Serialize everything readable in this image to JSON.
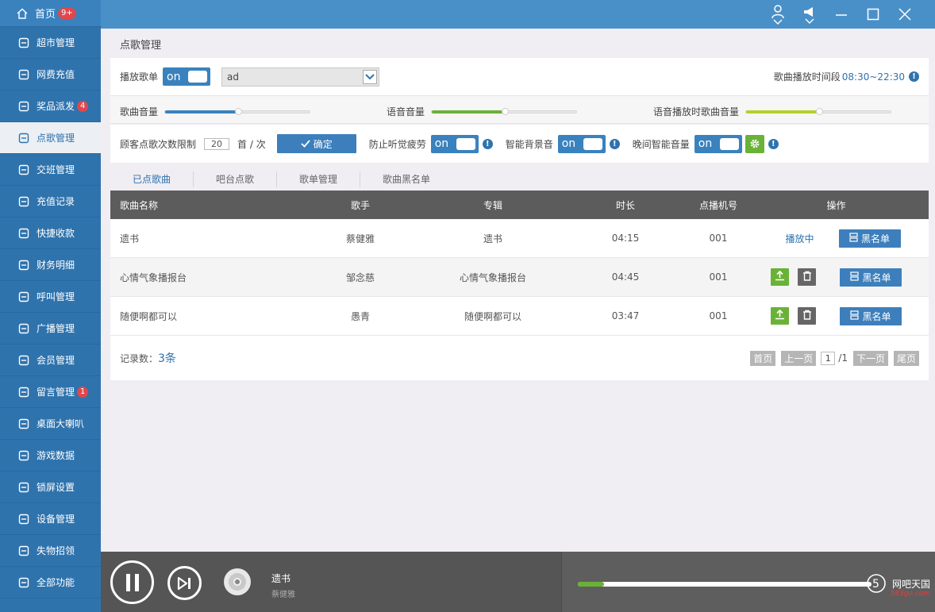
{
  "sidebar": {
    "home": {
      "label": "首页",
      "badge": "9+"
    },
    "items": [
      {
        "label": "超市管理",
        "icon": "store-icon"
      },
      {
        "label": "网费充值",
        "icon": "card-icon"
      },
      {
        "label": "奖品派发",
        "icon": "gift-icon",
        "badge": "4"
      },
      {
        "label": "点歌管理",
        "icon": "music-icon",
        "active": true
      },
      {
        "label": "交班管理",
        "icon": "shift-icon"
      },
      {
        "label": "充值记录",
        "icon": "record-icon"
      },
      {
        "label": "快捷收款",
        "icon": "coin-icon"
      },
      {
        "label": "财务明细",
        "icon": "finance-icon"
      },
      {
        "label": "呼叫管理",
        "icon": "call-icon"
      },
      {
        "label": "广播管理",
        "icon": "broadcast-icon"
      },
      {
        "label": "会员管理",
        "icon": "members-icon"
      },
      {
        "label": "留言管理",
        "icon": "message-icon",
        "badge": "1"
      },
      {
        "label": "桌面大喇叭",
        "icon": "speaker-icon"
      },
      {
        "label": "游戏数据",
        "icon": "bar-chart-icon"
      },
      {
        "label": "锁屏设置",
        "icon": "lock-icon"
      },
      {
        "label": "设备管理",
        "icon": "device-icon"
      },
      {
        "label": "失物招领",
        "icon": "lost-found-icon"
      },
      {
        "label": "全部功能",
        "icon": "grid-icon"
      }
    ]
  },
  "page_title": "点歌管理",
  "settings": {
    "playlist_label": "播放歌单",
    "toggle_on": "on",
    "playlist_select": "ad",
    "time_range_label": "歌曲播放时间段",
    "time_range_value": "08:30~22:30",
    "song_volume_label": "歌曲音量",
    "song_volume": 0.5,
    "voice_volume_label": "语音音量",
    "voice_volume": 0.5,
    "voice_song_volume_label": "语音播放时歌曲音量",
    "voice_song_volume": 0.5,
    "limit_label": "顾客点歌次数限制",
    "limit_value": "20",
    "limit_unit": "首 / 次",
    "confirm_label": "确定",
    "anti_fatigue_label": "防止听觉疲劳",
    "smart_bg_label": "智能背景音",
    "night_volume_label": "晚间智能音量"
  },
  "tabs": [
    {
      "label": "已点歌曲",
      "active": true
    },
    {
      "label": "吧台点歌"
    },
    {
      "label": "歌单管理"
    },
    {
      "label": "歌曲黑名单"
    }
  ],
  "table": {
    "headers": [
      "歌曲名称",
      "歌手",
      "专辑",
      "时长",
      "点播机号",
      "操作"
    ],
    "rows": [
      {
        "name": "遗书",
        "artist": "蔡健雅",
        "album": "遗书",
        "duration": "04:15",
        "machine": "001",
        "status": "播放中"
      },
      {
        "name": "心情气象播报台",
        "artist": "邹念慈",
        "album": "心情气象播报台",
        "duration": "04:45",
        "machine": "001",
        "status": ""
      },
      {
        "name": "随便啊都可以",
        "artist": "愚青",
        "album": "随便啊都可以",
        "duration": "03:47",
        "machine": "001",
        "status": ""
      }
    ],
    "blacklist_label": "黑名单",
    "count_label": "记录数：",
    "count_value": "3条"
  },
  "pager": {
    "first": "首页",
    "prev": "上一页",
    "page": "1",
    "total": "/1",
    "next": "下一页",
    "last": "尾页"
  },
  "player": {
    "title": "遗书",
    "artist": "蔡健雅",
    "progress": 0.09
  },
  "watermark": {
    "text": "网吧天国",
    "sub": "583go.com"
  },
  "colors": {
    "primary": "#2f73ad",
    "green": "#6ab237",
    "lime": "#b6cf2a"
  }
}
